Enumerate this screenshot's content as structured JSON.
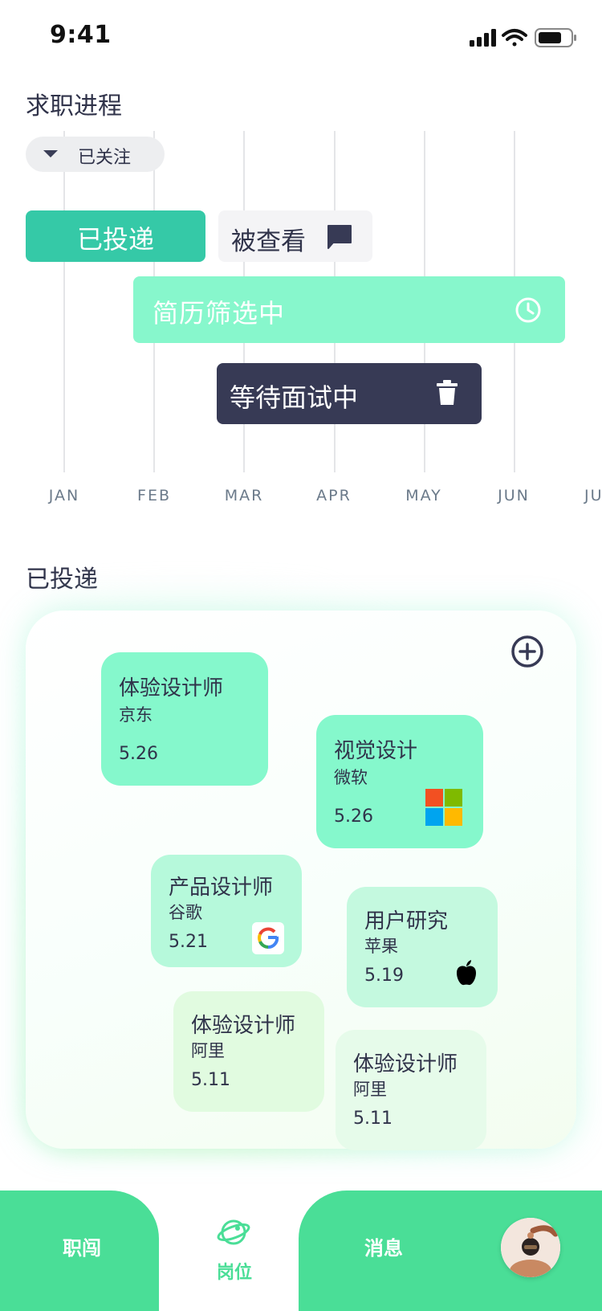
{
  "status_bar": {
    "time": "9:41"
  },
  "progress": {
    "title": "求职进程",
    "filter": {
      "label": "已关注",
      "icon": "caret-down-icon"
    },
    "months": [
      "JAN",
      "FEB",
      "MAR",
      "APR",
      "MAY",
      "JUN",
      "JU"
    ],
    "stages": [
      {
        "label": "已投递",
        "color": "#35c9a7"
      },
      {
        "label": "被查看",
        "icon": "chat-icon",
        "color": "#f4f4f6"
      },
      {
        "label": "简历筛选中",
        "icon": "clock-icon",
        "color": "#87f7cc"
      },
      {
        "label": "等待面试中",
        "icon": "trash-icon",
        "color": "#373a55"
      }
    ]
  },
  "applied": {
    "title": "已投递",
    "add_icon": "add-circle-icon",
    "cards": [
      {
        "title": "体验设计师",
        "company": "京东",
        "date": "5.26"
      },
      {
        "title": "视觉设计",
        "company": "微软",
        "date": "5.26",
        "logo": "microsoft-logo"
      },
      {
        "title": "产品设计师",
        "company": "谷歌",
        "date": "5.21",
        "logo": "google-logo"
      },
      {
        "title": "用户研究",
        "company": "苹果",
        "date": "5.19",
        "logo": "apple-logo"
      },
      {
        "title": "体验设计师",
        "company": "阿里",
        "date": "5.11"
      },
      {
        "title": "体验设计师",
        "company": "阿里",
        "date": "5.11"
      }
    ]
  },
  "nav": {
    "career": "职闯",
    "jobs": "岗位",
    "messages": "消息",
    "active": "jobs",
    "accent": "#4ade97"
  }
}
